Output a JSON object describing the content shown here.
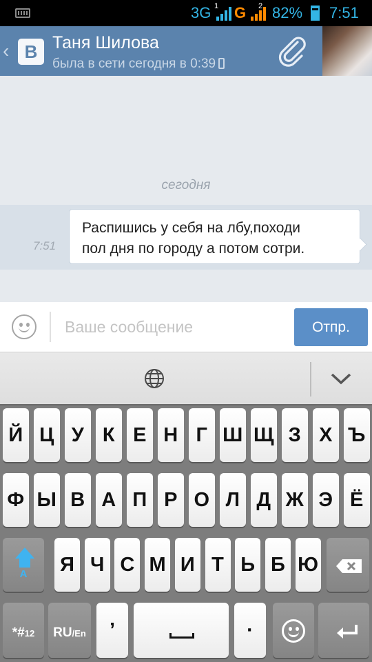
{
  "status_bar": {
    "network": "3G",
    "network2": "G",
    "sim1": "1",
    "sim2": "2",
    "battery": "82%",
    "time": "7:51",
    "colors": {
      "accent": "#33b5e5",
      "data": "#ff8a00"
    }
  },
  "header": {
    "back_icon": "chevron-left-icon",
    "logo": "B",
    "name": "Таня Шилова",
    "status": "была в сети сегодня в 0:39",
    "status_device_icon": "phone-icon",
    "attach_icon": "paperclip-icon",
    "color": "#5b83ad"
  },
  "chat": {
    "date_separator": "сегодня",
    "messages": [
      {
        "time": "7:51",
        "line1": "Распишись у себя на лбу,походи",
        "line2": "пол дня по городу а потом сотри."
      }
    ]
  },
  "input": {
    "emoji_icon": "smiley-icon",
    "placeholder": "Ваше сообщение",
    "value": "",
    "send_label": "Отпр."
  },
  "keyboard_toolbar": {
    "globe_icon": "globe-icon",
    "collapse_icon": "chevron-down-icon"
  },
  "keyboard": {
    "row1": [
      "Й",
      "Ц",
      "У",
      "К",
      "Е",
      "Н",
      "Г",
      "Ш",
      "Щ",
      "З",
      "Х",
      "Ъ"
    ],
    "row2": [
      "Ф",
      "Ы",
      "В",
      "А",
      "П",
      "Р",
      "О",
      "Л",
      "Д",
      "Ж",
      "Э",
      "Ё"
    ],
    "row3": [
      "Я",
      "Ч",
      "С",
      "М",
      "И",
      "Т",
      "Ь",
      "Б",
      "Ю"
    ],
    "shift_label": "A",
    "symbols_label": "*#",
    "symbols_sub": "12",
    "lang_label": "RU",
    "lang_sub": "/En",
    "comma": "’",
    "period": "·"
  }
}
